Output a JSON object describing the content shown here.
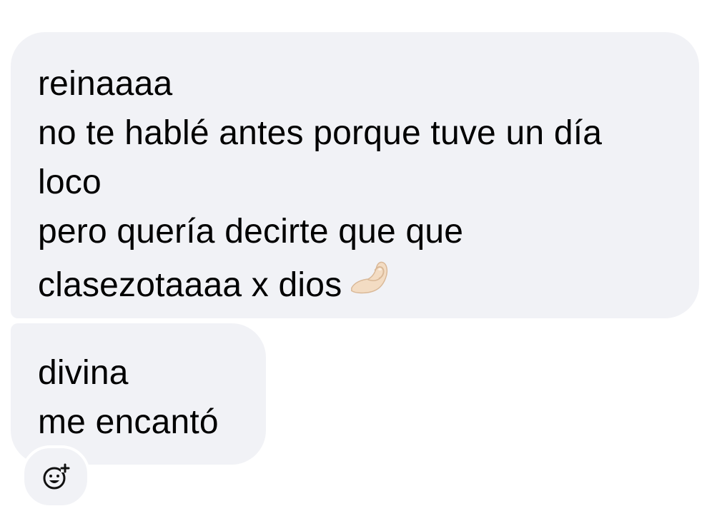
{
  "chat": {
    "messages": [
      {
        "lines": [
          "reinaaaa",
          "no te hablé antes porque tuve un día",
          "loco",
          "pero quería decirte que que",
          "clasezotaaaa x dios"
        ],
        "emoji": "pinched-fingers-emoji"
      },
      {
        "lines": [
          "divina",
          "me encantó"
        ]
      }
    ],
    "reaction_icon": "add-reaction-icon"
  },
  "colors": {
    "bubble_background": "#f1f2f6",
    "text": "#000000",
    "page_background": "#ffffff"
  }
}
